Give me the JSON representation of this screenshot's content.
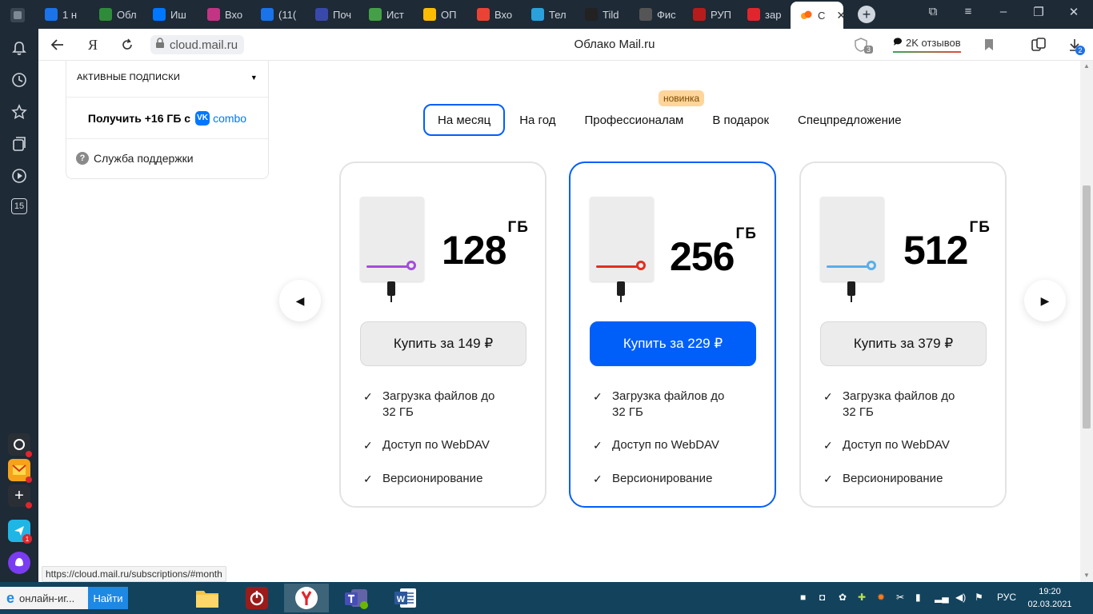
{
  "browser": {
    "tabs": [
      {
        "label": "1 н",
        "icon": "one-icon",
        "color": "#1a73e8"
      },
      {
        "label": "Обл",
        "icon": "money-bag-icon",
        "color": "#2e8b3a"
      },
      {
        "label": "Иш",
        "icon": "vk-icon",
        "color": "#0077ff"
      },
      {
        "label": "Вхо",
        "icon": "instagram-icon",
        "color": "#c13584"
      },
      {
        "label": "(11(",
        "icon": "mail-icon",
        "color": "#1a73e8"
      },
      {
        "label": "Поч",
        "icon": "emblem-icon",
        "color": "#3949ab"
      },
      {
        "label": "Ист",
        "icon": "leaf-icon",
        "color": "#43a047"
      },
      {
        "label": "ОП",
        "icon": "drive-icon",
        "color": "#fbbc04"
      },
      {
        "label": "Вхо",
        "icon": "gmail-icon",
        "color": "#ea4335"
      },
      {
        "label": "Тел",
        "icon": "telegram-icon",
        "color": "#2aa1da"
      },
      {
        "label": "Tild",
        "icon": "tilda-icon",
        "color": "#222"
      },
      {
        "label": "Фис",
        "icon": "fns-icon",
        "color": "#555"
      },
      {
        "label": "РУП",
        "icon": "coat-of-arms-icon",
        "color": "#b71c1c"
      },
      {
        "label": "зар",
        "icon": "yandex-icon",
        "color": "#e0262c"
      }
    ],
    "active_tab": {
      "label": "С",
      "icon": "cloud-icon",
      "close": "✕"
    },
    "url": "cloud.mail.ru",
    "page_title": "Облако Mail.ru",
    "reviews_label": "2K отзывов",
    "protect_count": "3",
    "downloads_count": "2",
    "status_url": "https://cloud.mail.ru/subscriptions/#month"
  },
  "sidebar": {
    "active_subscriptions": "АКТИВНЫЕ ПОДПИСКИ",
    "combo_prefix": "Получить +16 ГБ с",
    "combo_word": "combo",
    "vk_badge": "VK",
    "support": "Служба поддержки",
    "badge_count": "15"
  },
  "plans": {
    "tabs": [
      "На месяц",
      "На год",
      "Профессионалам",
      "В подарок",
      "Спецпредложение"
    ],
    "active_tab": "На месяц",
    "new_badge": "новинка",
    "cards": [
      {
        "size": "128",
        "unit": "ГБ",
        "buy": "Купить за 149 ₽",
        "accent": "#a64bdb",
        "featured": false,
        "features": [
          "Загрузка файлов до 32 ГБ",
          "Доступ по WebDAV",
          "Версионирование"
        ]
      },
      {
        "size": "256",
        "unit": "ГБ",
        "buy": "Купить за 229 ₽",
        "accent": "#e0301e",
        "featured": true,
        "features": [
          "Загрузка файлов до 32 ГБ",
          "Доступ по WebDAV",
          "Версионирование"
        ]
      },
      {
        "size": "512",
        "unit": "ГБ",
        "buy": "Купить за 379 ₽",
        "accent": "#5aaee8",
        "featured": false,
        "features": [
          "Загрузка файлов до 32 ГБ",
          "Доступ по WebDAV",
          "Версионирование"
        ]
      }
    ]
  },
  "taskbar": {
    "search_query": "онлайн-иг...",
    "search_button": "Найти",
    "lang": "РУС",
    "time": "19:20",
    "date": "02.03.2021"
  },
  "colors": {
    "accent": "#005ff9",
    "browser_chrome": "#1e2a36",
    "taskbar": "#13425c"
  }
}
